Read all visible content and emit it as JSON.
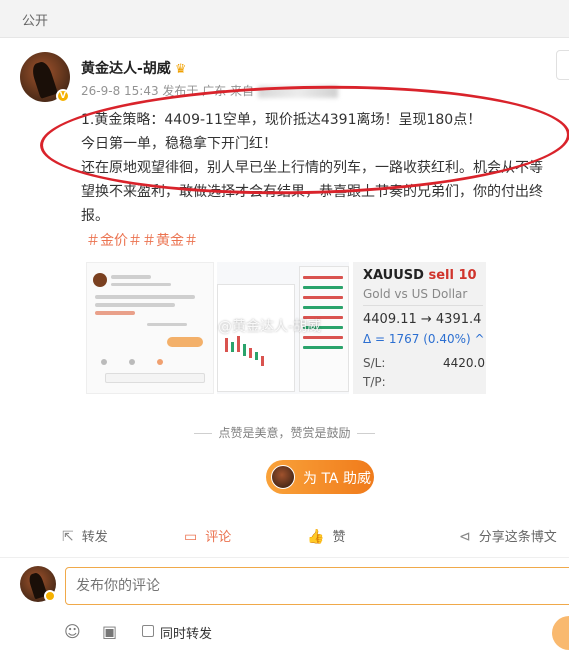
{
  "visibility_label": "公开",
  "author": {
    "name": "黄金达人-胡威",
    "badge": "V"
  },
  "meta": {
    "text": "26-9-8 15:43  发布于 广东  来自"
  },
  "post": {
    "lines": [
      "1.黄金策略：4409-11空单，现价抵达4391离场！呈现180点！",
      "今日第一单，稳稳拿下开门红！",
      "还在原地观望徘徊，别人早已坐上行情的列车，一路收获红利。机会从不等",
      "望换不来盈利，敢做选择才会有结果，恭喜跟上节奏的兄弟们，你的付出终",
      "报。"
    ],
    "tags": "＃金价＃＃黄金＃"
  },
  "trade_card": {
    "pair": "XAUUSD",
    "side": "sell 10",
    "subtitle": "Gold vs US Dollar",
    "price_move": "4409.11 → 4391.4",
    "delta": "Δ = 1767 (0.40%) ^",
    "sl_label": "S/L:",
    "sl_value": "4420.0(",
    "tp_label": "T/P:"
  },
  "watermark": "@黄金达人-胡威",
  "like_hint": "点赞是美意，赞赏是鼓励",
  "tip_button": "为 TA 助威",
  "actions": {
    "repost": "转发",
    "comment": "评论",
    "like": "赞",
    "share": "分享这条博文"
  },
  "comment_box": {
    "placeholder": "发布你的评论"
  },
  "tools": {
    "repost_label": "同时转发"
  },
  "colors": {
    "accent": "#eb7350",
    "highlight_ellipse": "#d9232b",
    "tip_button": "#f07b1b"
  },
  "icons": [
    "crown-icon",
    "verified-icon",
    "repost-icon",
    "comment-icon",
    "like-icon",
    "share-icon",
    "emoji-icon",
    "image-icon",
    "send-icon"
  ]
}
